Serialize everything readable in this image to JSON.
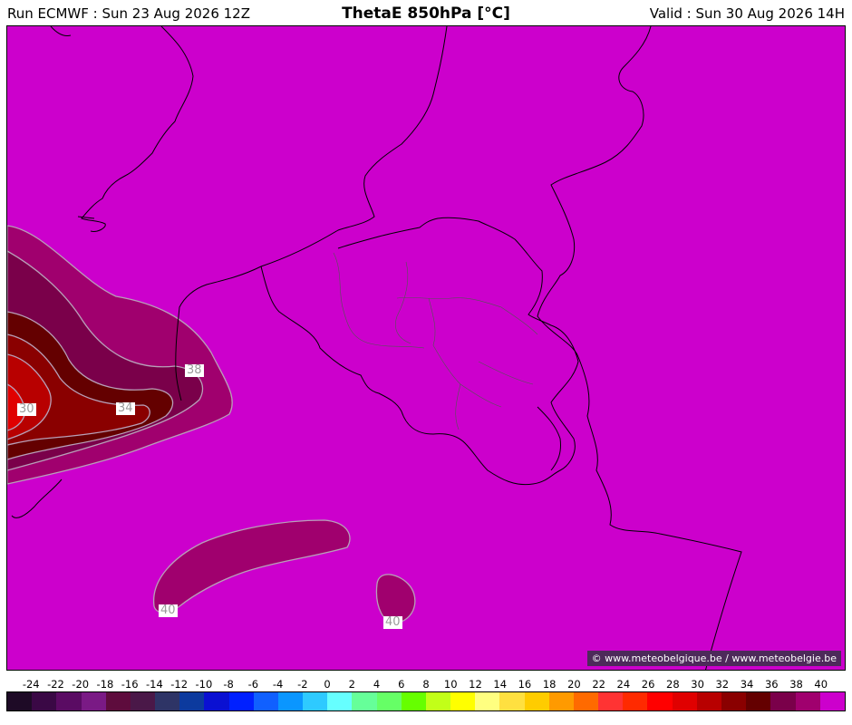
{
  "header": {
    "run": "Run ECMWF : Sun 23 Aug 2026 12Z",
    "title": "ThetaE 850hPa [°C]",
    "valid": "Valid : Sun 30 Aug 2026 14H"
  },
  "map": {
    "background_color": "#cc00cc",
    "contour_labels": [
      "38",
      "34",
      "30",
      "40",
      "40"
    ],
    "credit": "© www.meteobelgique.be / www.meteobelgie.be"
  },
  "colorbar": {
    "ticks": [
      "-24",
      "-22",
      "-20",
      "-18",
      "-16",
      "-14",
      "-12",
      "-10",
      "-8",
      "-6",
      "-4",
      "-2",
      "0",
      "2",
      "4",
      "6",
      "8",
      "10",
      "12",
      "14",
      "16",
      "18",
      "20",
      "22",
      "24",
      "26",
      "28",
      "30",
      "32",
      "34",
      "36",
      "38",
      "40"
    ],
    "colors": [
      "#1e0a26",
      "#3a0845",
      "#5a0b63",
      "#7a1a85",
      "#5e0c3d",
      "#4a1848",
      "#2e3466",
      "#0c3a9e",
      "#0a10d2",
      "#0020ff",
      "#1060ff",
      "#0a96ff",
      "#2ecaff",
      "#66ffff",
      "#66ff99",
      "#66ff66",
      "#66ff00",
      "#c2ff18",
      "#ffff00",
      "#ffff80",
      "#ffe040",
      "#ffcc00",
      "#ff9a00",
      "#ff6a00",
      "#ff3333",
      "#ff2a00",
      "#ff0000",
      "#e00000",
      "#b80000",
      "#8a0000",
      "#640000",
      "#7a004a",
      "#a0006e",
      "#cc00cc"
    ]
  }
}
